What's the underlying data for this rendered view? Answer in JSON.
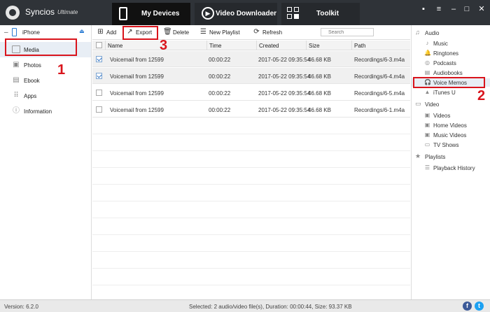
{
  "titlebar": {
    "app_name": "Syncios",
    "app_edition": "Ultimate",
    "tabs": [
      {
        "label": "My Devices"
      },
      {
        "label": "Video Downloader"
      },
      {
        "label": "Toolkit"
      }
    ]
  },
  "sidebar_left": {
    "device": "iPhone",
    "items": [
      {
        "label": "Media"
      },
      {
        "label": "Photos"
      },
      {
        "label": "Ebook"
      },
      {
        "label": "Apps"
      },
      {
        "label": "Information"
      }
    ]
  },
  "toolbar": {
    "add": "Add",
    "export": "Export",
    "delete": "Delete",
    "new_playlist": "New Playlist",
    "refresh": "Refresh",
    "search_placeholder": "Search"
  },
  "table": {
    "columns": [
      "Name",
      "Time",
      "Created",
      "Size",
      "Path"
    ],
    "rows": [
      {
        "name": "Voicemail from 12599",
        "time": "00:00:22",
        "created": "2017-05-22 09:35:54",
        "size": "46.68 KB",
        "path": "Recordings/6-3.m4a",
        "checked": true
      },
      {
        "name": "Voicemail from 12599",
        "time": "00:00:22",
        "created": "2017-05-22 09:35:54",
        "size": "46.68 KB",
        "path": "Recordings/6-4.m4a",
        "checked": true
      },
      {
        "name": "Voicemail from 12599",
        "time": "00:00:22",
        "created": "2017-05-22 09:35:54",
        "size": "46.68 KB",
        "path": "Recordings/6-5.m4a",
        "checked": false
      },
      {
        "name": "Voicemail from 12599",
        "time": "00:00:22",
        "created": "2017-05-22 09:35:54",
        "size": "46.68 KB",
        "path": "Recordings/6-1.m4a",
        "checked": false
      }
    ]
  },
  "sidebar_right": {
    "audio": {
      "label": "Audio",
      "items": [
        "Music",
        "Ringtones",
        "Podcasts",
        "Audiobooks",
        "Voice Memos",
        "iTunes U"
      ]
    },
    "video": {
      "label": "Video",
      "items": [
        "Videos",
        "Home Videos",
        "Music Videos",
        "TV Shows"
      ]
    },
    "playlists": {
      "label": "Playlists",
      "items": [
        "Playback History"
      ]
    }
  },
  "statusbar": {
    "version": "Version: 6.2.0",
    "status": "Selected: 2 audio/video file(s), Duration: 00:00:44, Size: 93.37 KB"
  },
  "annotations": [
    "1",
    "2",
    "3"
  ],
  "colors": {
    "titlebar": "#2f3338",
    "active_tab": "#111111",
    "accent": "#2b7cd3",
    "annotation_red": "#d9141c",
    "facebook": "#3b5998",
    "twitter": "#1da1f2"
  }
}
